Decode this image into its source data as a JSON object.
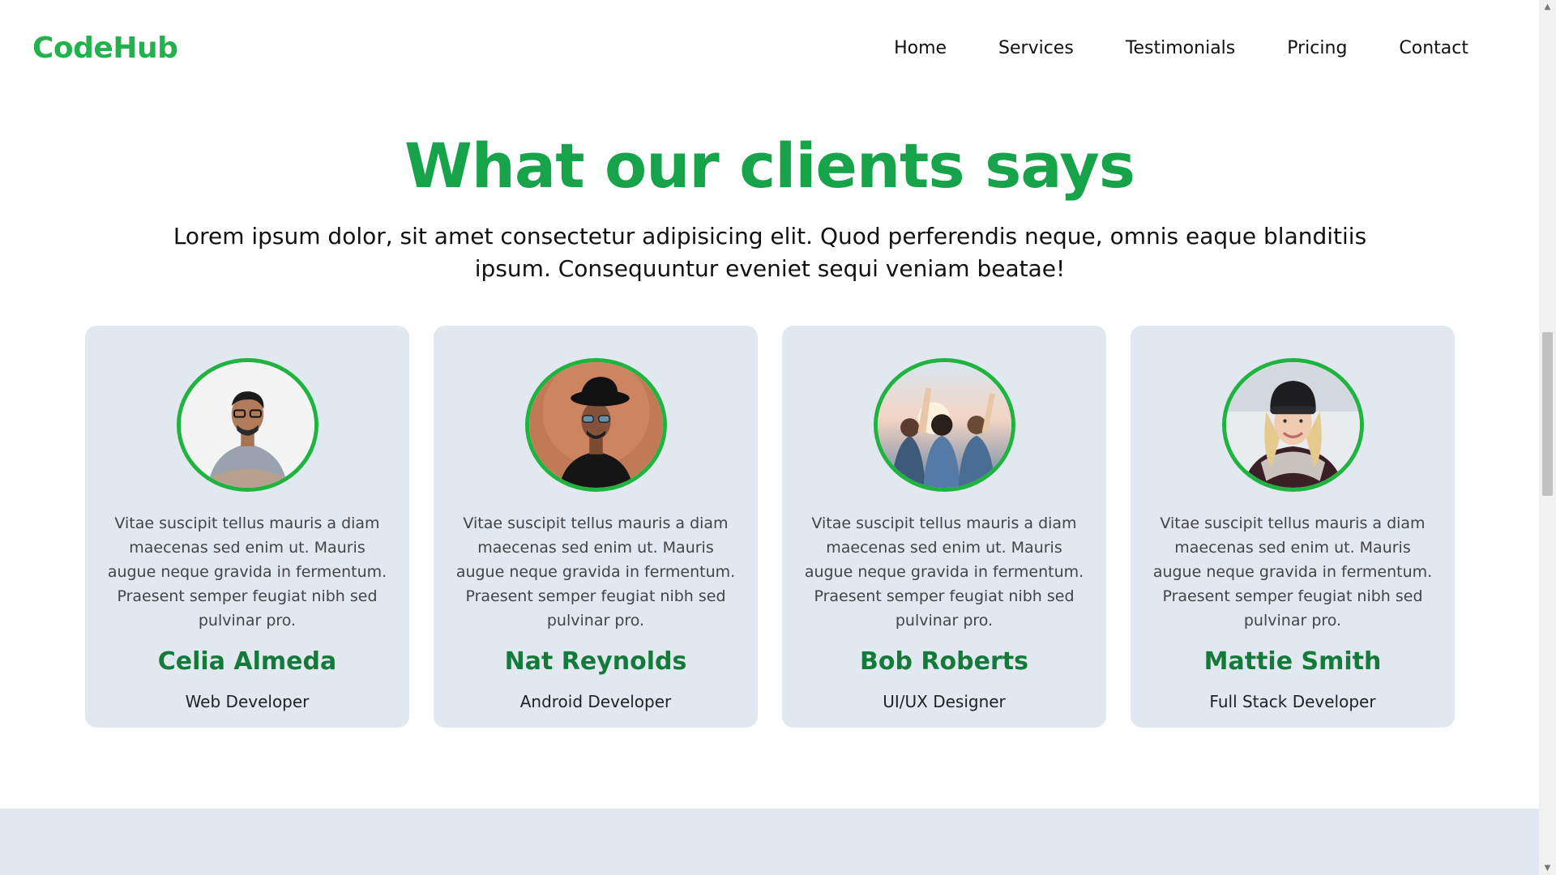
{
  "navbar": {
    "logo": "CodeHub",
    "links": [
      "Home",
      "Services",
      "Testimonials",
      "Pricing",
      "Contact"
    ]
  },
  "section": {
    "title": "What our clients says",
    "subtitle": "Lorem ipsum dolor, sit amet consectetur adipisicing elit. Quod perferendis neque, omnis eaque blanditiis ipsum. Consequuntur eveniet sequi veniam beatae!"
  },
  "testimonials": [
    {
      "quote": "Vitae suscipit tellus mauris a diam maecenas sed enim ut. Mauris augue neque gravida in fermentum. Praesent semper feugiat nibh sed pulvinar pro.",
      "name": "Celia Almeda",
      "role": "Web Developer",
      "photo_icon": "man-glasses-grey-tshirt-photo"
    },
    {
      "quote": "Vitae suscipit tellus mauris a diam maecenas sed enim ut. Mauris augue neque gravida in fermentum. Praesent semper feugiat nibh sed pulvinar pro.",
      "name": "Nat Reynolds",
      "role": "Android Developer",
      "photo_icon": "man-black-hat-photo"
    },
    {
      "quote": "Vitae suscipit tellus mauris a diam maecenas sed enim ut. Mauris augue neque gravida in fermentum. Praesent semper feugiat nibh sed pulvinar pro.",
      "name": "Bob Roberts",
      "role": "UI/UX Designer",
      "photo_icon": "group-of-friends-photo"
    },
    {
      "quote": "Vitae suscipit tellus mauris a diam maecenas sed enim ut. Mauris augue neque gravida in fermentum. Praesent semper feugiat nibh sed pulvinar pro.",
      "name": "Mattie Smith",
      "role": "Full Stack Developer",
      "photo_icon": "woman-beanie-scarf-photo"
    }
  ],
  "colors": {
    "brand_green": "#22b14c",
    "title_green": "#16a34a",
    "name_green": "#137a3a",
    "card_bg": "#e2e8f0"
  }
}
